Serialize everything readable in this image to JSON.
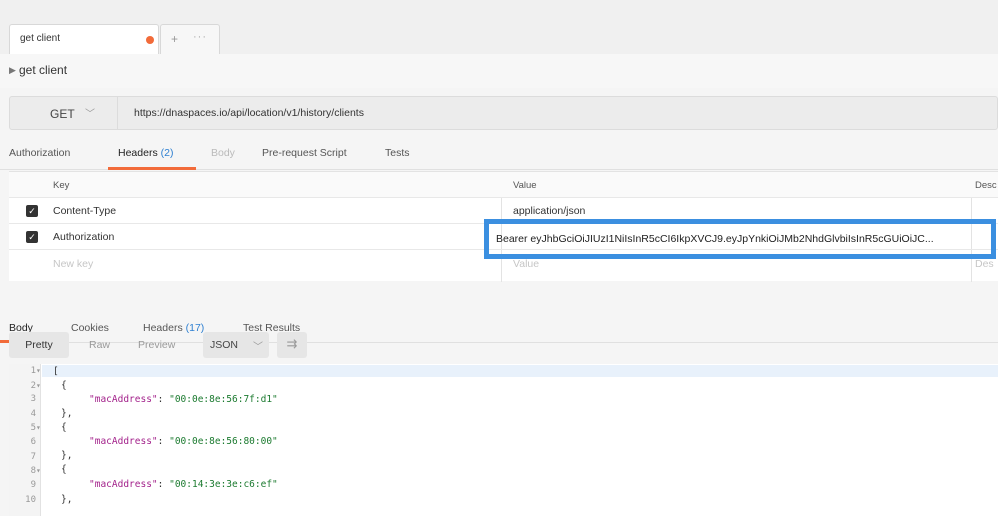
{
  "tabbar": {
    "request_tab_label": "get client",
    "add_tab": "+",
    "more_tabs": "···"
  },
  "request": {
    "title": "get client",
    "method": "GET",
    "url": "https://dnaspaces.io/api/location/v1/history/clients"
  },
  "request_tabs": [
    {
      "label": "Authorization",
      "count": ""
    },
    {
      "label": "Headers",
      "count": "(2)"
    },
    {
      "label": "Body",
      "count": ""
    },
    {
      "label": "Pre-request Script",
      "count": ""
    },
    {
      "label": "Tests",
      "count": ""
    }
  ],
  "headers_table": {
    "columns": [
      "Key",
      "Value",
      "Desc"
    ],
    "rows": [
      {
        "key": "Content-Type",
        "value": "application/json"
      },
      {
        "key": "Authorization",
        "value": "Bearer eyJhbGciOiJIUzI1NiIsInR5cCI6IkpXVCJ9.eyJpYnkiOiJMb2NhdGlvbiIsInR5cGUiOiJC..."
      }
    ],
    "new_key_placeholder": "New key",
    "value_placeholder": "Value",
    "desc_placeholder": "Des"
  },
  "response_tabs": [
    {
      "label": "Body",
      "count": ""
    },
    {
      "label": "Cookies",
      "count": ""
    },
    {
      "label": "Headers",
      "count": "(17)"
    },
    {
      "label": "Test Results",
      "count": ""
    }
  ],
  "response_toolbar": {
    "pretty": "Pretty",
    "raw": "Raw",
    "preview": "Preview",
    "format": "JSON"
  },
  "code": {
    "line_numbers": [
      "1",
      "2",
      "3",
      "4",
      "5",
      "6",
      "7",
      "8",
      "9",
      "10"
    ],
    "open_bracket": "[",
    "open_brace": "{",
    "close_brace": "},",
    "field_key": "\"macAddress\"",
    "mac_values": [
      "\"00:0e:8e:56:7f:d1\"",
      "\"00:0e:8e:56:80:00\"",
      "\"00:14:3e:3e:c6:ef\""
    ]
  },
  "colors": {
    "accent": "#f26b3a",
    "highlight_border": "#3b8fe0",
    "count_blue": "#2f80d1"
  }
}
